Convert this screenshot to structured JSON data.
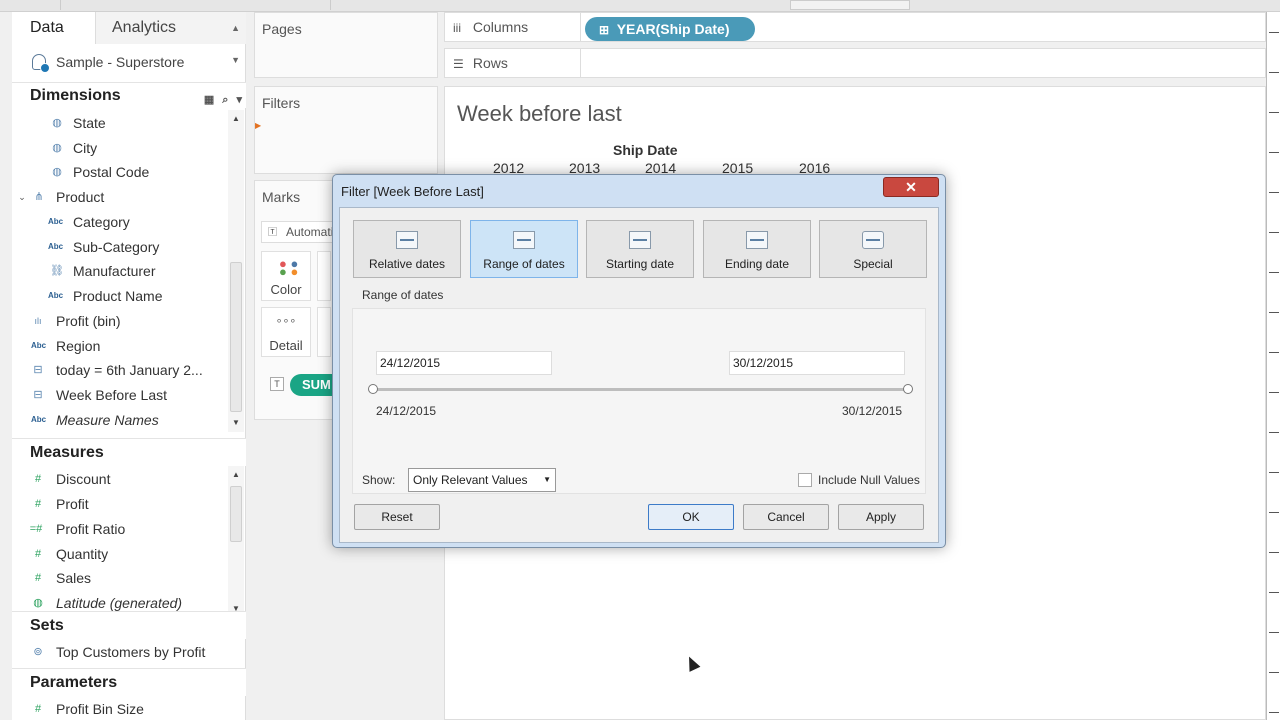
{
  "datapane": {
    "tab_data": "Data",
    "tab_analytics": "Analytics",
    "datasource": "Sample - Superstore",
    "dimensions_heading": "Dimensions",
    "dimensions": [
      {
        "label": "State",
        "icon": "globe-icon"
      },
      {
        "label": "City",
        "icon": "globe-icon"
      },
      {
        "label": "Postal Code",
        "icon": "globe-icon"
      },
      {
        "label": "Product",
        "icon": "hierarchy-icon"
      },
      {
        "label": "Category",
        "icon": "abc-icon"
      },
      {
        "label": "Sub-Category",
        "icon": "abc-icon"
      },
      {
        "label": "Manufacturer",
        "icon": "link-icon"
      },
      {
        "label": "Product Name",
        "icon": "abc-icon"
      },
      {
        "label": "Profit (bin)",
        "icon": "bin-icon"
      },
      {
        "label": "Region",
        "icon": "abc-icon"
      },
      {
        "label": "today = 6th January 2...",
        "icon": "calc-icon"
      },
      {
        "label": "Week Before Last",
        "icon": "calc-icon"
      },
      {
        "label": "Measure Names",
        "icon": "abc-icon"
      }
    ],
    "measures_heading": "Measures",
    "measures": [
      {
        "label": "Discount",
        "icon": "hash-icon"
      },
      {
        "label": "Profit",
        "icon": "hash-icon"
      },
      {
        "label": "Profit Ratio",
        "icon": "calc-hash-icon"
      },
      {
        "label": "Quantity",
        "icon": "hash-icon"
      },
      {
        "label": "Sales",
        "icon": "hash-icon"
      },
      {
        "label": "Latitude (generated)",
        "icon": "globe-icon"
      }
    ],
    "sets_heading": "Sets",
    "sets": [
      {
        "label": "Top Customers by Profit",
        "icon": "set-icon"
      }
    ],
    "parameters_heading": "Parameters",
    "parameters": [
      {
        "label": "Profit Bin Size",
        "icon": "hash-icon"
      }
    ]
  },
  "shelves": {
    "pages": "Pages",
    "filters": "Filters",
    "marks": "Marks",
    "marks_type": "Automatic",
    "color": "Color",
    "detail": "Detail",
    "pill_partial": "SUM"
  },
  "canvas": {
    "columns_label": "Columns",
    "rows_label": "Rows",
    "columns_pill": "YEAR(Ship Date)",
    "sheet_title": "Week before last",
    "x_header": "Ship Date",
    "years": [
      "2012",
      "2013",
      "2014",
      "2015",
      "2016"
    ]
  },
  "dialog": {
    "title": "Filter [Week Before Last]",
    "close": "✕",
    "modes": [
      "Relative dates",
      "Range of dates",
      "Starting date",
      "Ending date",
      "Special"
    ],
    "active_mode": "Range of dates",
    "section_label": "Range of dates",
    "start_date": "24/12/2015",
    "end_date": "30/12/2015",
    "slider_min_label": "24/12/2015",
    "slider_max_label": "30/12/2015",
    "show_label": "Show:",
    "show_value": "Only Relevant Values",
    "include_null": "Include Null Values",
    "include_null_checked": false,
    "reset": "Reset",
    "ok": "OK",
    "cancel": "Cancel",
    "apply": "Apply"
  },
  "colors": {
    "accent_blue": "#4a9ab8",
    "measure_green": "#1aa585",
    "dialog_frame": "#cfe0f3",
    "close_red": "#c9483f"
  }
}
